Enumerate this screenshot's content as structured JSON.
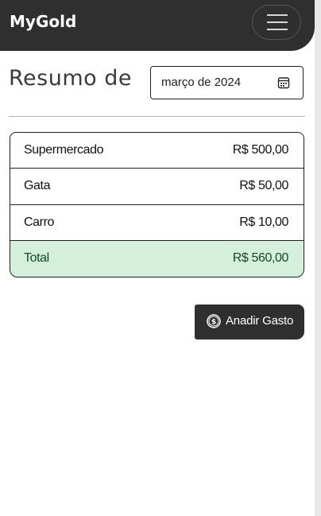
{
  "navbar": {
    "brand": "MyGold",
    "menu_icon": "hamburger-menu-icon"
  },
  "summary": {
    "heading": "Resumo de",
    "month_value": "março de 2024",
    "calendar_icon": "calendar-icon"
  },
  "expenses": [
    {
      "name": "Supermercado",
      "amount": "R$ 500,00"
    },
    {
      "name": "Gata",
      "amount": "R$ 50,00"
    },
    {
      "name": "Carro",
      "amount": "R$ 10,00"
    }
  ],
  "total": {
    "label": "Total",
    "amount": "R$ 560,00"
  },
  "add_button": {
    "icon": "coin-dollar-icon",
    "label": "Anadir Gasto"
  },
  "colors": {
    "navbar_bg": "#2f2f2f",
    "total_row_bg": "#d4efdc",
    "total_text": "#114a2a"
  }
}
